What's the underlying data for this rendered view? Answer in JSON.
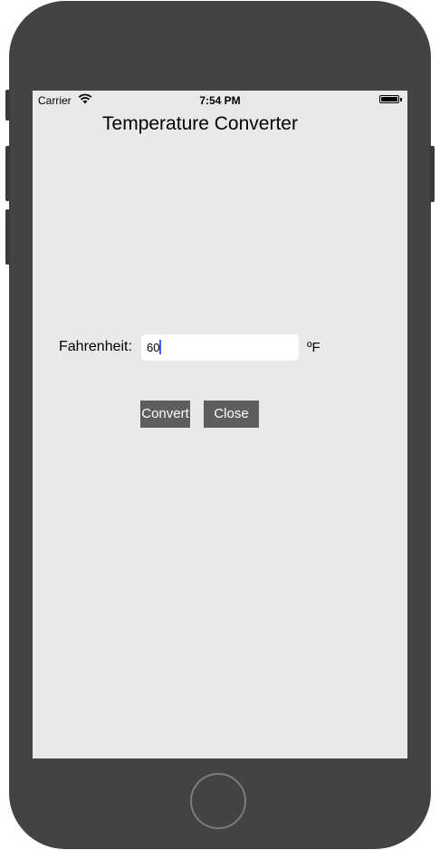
{
  "status_bar": {
    "carrier": "Carrier",
    "time": "7:54 PM",
    "wifi_icon": "wifi-icon",
    "battery_icon": "battery-icon"
  },
  "app": {
    "title": "Temperature Converter"
  },
  "form": {
    "label": "Fahrenheit:",
    "value": "60",
    "unit": "ºF"
  },
  "buttons": {
    "convert": "Convert",
    "close": "Close"
  },
  "colors": {
    "screen_background": "#e9e9e9",
    "button_background": "#5e5e5e",
    "device_frame": "#434343",
    "caret": "#3d5bf5"
  }
}
